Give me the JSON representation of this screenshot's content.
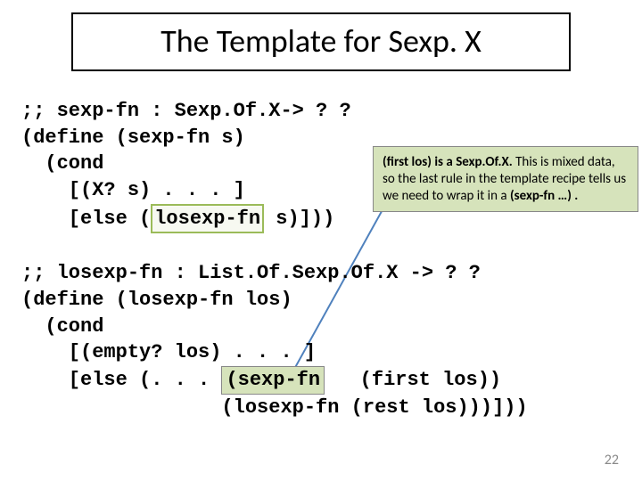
{
  "title": "The Template for Sexp. X",
  "code": {
    "l1": ";; sexp-fn : Sexp.Of.X-> ? ?",
    "l2": "(define (sexp-fn s)",
    "l3": "  (cond",
    "l4": "    [(X? s) . . . ]",
    "l5_a": "    [else (",
    "l5_hl": "losexp-fn",
    "l5_b": " s)]))",
    "l6": "",
    "l7": ";; losexp-fn : List.Of.Sexp.Of.X -> ? ?",
    "l8": "(define (losexp-fn los)",
    "l9": "  (cond",
    "l10": "    [(empty? los) . . . ]",
    "l11_a": "    [else (. . . ",
    "l11_hl": "(sexp-fn",
    "l11_b": "   (first los))",
    "l12": "                 (losexp-fn (rest los)))]))"
  },
  "callout": {
    "bold": "(first los) is a Sexp.Of.X.",
    "rest": "  This is mixed data, so the last rule in the template recipe tells us we need to wrap it in a ",
    "bold2": "(sexp-fn …) ."
  },
  "page_number": "22"
}
